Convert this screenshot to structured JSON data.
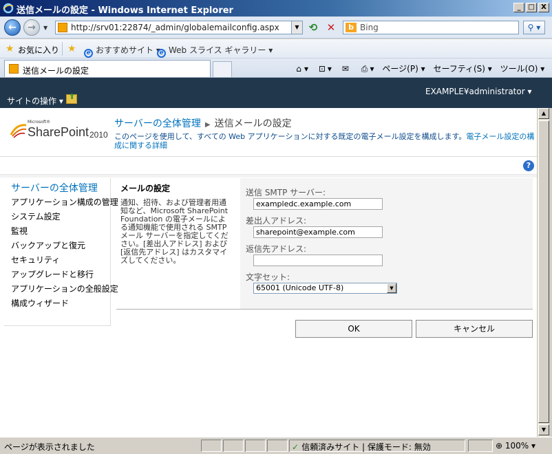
{
  "window": {
    "title": "送信メールの設定 - Windows Internet Explorer",
    "controls": [
      "_",
      "□",
      "X"
    ]
  },
  "nav": {
    "url": "http://srv01:22874/_admin/globalemailconfig.aspx",
    "search_placeholder": "Bing"
  },
  "favorites": {
    "label": "お気に入り",
    "items": [
      "おすすめサイト ▾",
      "Web スライス ギャラリー ▾"
    ]
  },
  "tab": {
    "title": "送信メールの設定"
  },
  "commandbar": {
    "page": "ページ(P) ▾",
    "safety": "セーフティ(S) ▾",
    "tools": "ツール(O) ▾"
  },
  "sp": {
    "user": "EXAMPLE¥administrator ▾",
    "site_actions": "サイトの操作 ▾",
    "logo_ms": "Microsoft®",
    "logo_name": "SharePoint",
    "logo_year": "2010",
    "breadcrumb_root": "サーバーの全体管理",
    "breadcrumb_current": "送信メールの設定",
    "description": "このページを使用して、すべての Web アプリケーションに対する既定の電子メール設定を構成します。",
    "description_link": "電子メール設定の構成に関する詳細"
  },
  "leftnav": {
    "heading": "サーバーの全体管理",
    "items": [
      "アプリケーション構成の管理",
      "システム設定",
      "監視",
      "バックアップと復元",
      "セキュリティ",
      "アップグレードと移行",
      "アプリケーションの全般設定",
      "構成ウィザード"
    ]
  },
  "form": {
    "section_title": "メールの設定",
    "section_description": "通知、招待、および管理者用通知など、Microsoft SharePoint Foundation の電子メールによる通知機能で使用される SMTP メール サーバーを指定してください。[差出人アドレス] および [返信先アドレス] はカスタマイズしてください。",
    "smtp_label": "送信 SMTP サーバー:",
    "smtp_value": "exampledc.example.com",
    "from_label": "差出人アドレス:",
    "from_value": "sharepoint@example.com",
    "reply_label": "返信先アドレス:",
    "reply_value": "",
    "charset_label": "文字セット:",
    "charset_value": "65001 (Unicode UTF-8)",
    "ok": "OK",
    "cancel": "キャンセル"
  },
  "status": {
    "text": "ページが表示されました",
    "zone": "信頼済みサイト | 保護モード: 無効",
    "zoom": "100%"
  }
}
